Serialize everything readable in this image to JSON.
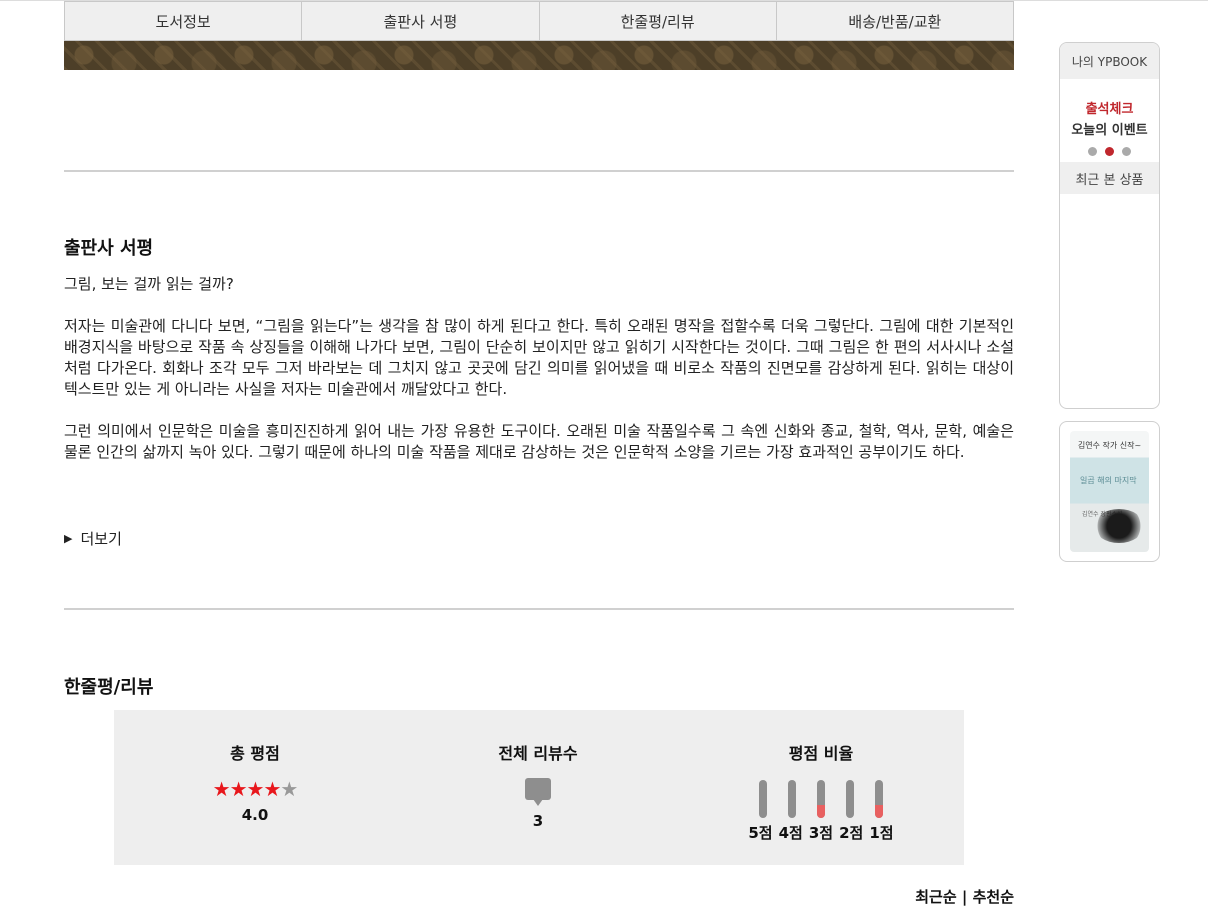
{
  "tabs": [
    "도서정보",
    "출판사 서평",
    "한줄평/리뷰",
    "배송/반품/교환"
  ],
  "publisher_review": {
    "title": "출판사 서평",
    "question": "그림, 보는 걸까 읽는 걸까?",
    "paragraph1": "저자는 미술관에 다니다 보면, “그림을 읽는다”는 생각을 참 많이 하게 된다고 한다. 특히 오래된 명작을 접할수록 더욱 그렇단다. 그림에 대한 기본적인 배경지식을 바탕으로 작품 속 상징들을 이해해 나가다 보면, 그림이 단순히 보이지만 않고 읽히기 시작한다는 것이다. 그때 그림은 한 편의 서사시나 소설처럼 다가온다. 회화나 조각 모두 그저 바라보는 데 그치지 않고 곳곳에 담긴 의미를 읽어냈을 때 비로소 작품의 진면모를 감상하게 된다. 읽히는 대상이 텍스트만 있는 게 아니라는 사실을 저자는 미술관에서 깨달았다고 한다.",
    "paragraph2": "그런 의미에서 인문학은 미술을 흥미진진하게 읽어 내는 가장 유용한 도구이다. 오래된 미술 작품일수록 그 속엔 신화와 종교, 철학, 역사, 문학, 예술은 물론 인간의 삶까지 녹아 있다. 그렇기 때문에 하나의 미술 작품을 제대로 감상하는 것은 인문학적 소양을 기르는 가장 효과적인 공부이기도 하다.",
    "more_label": "더보기"
  },
  "reviews": {
    "title": "한줄평/리뷰",
    "total_rating_label": "총 평점",
    "rating_value": "4.0",
    "stars_filled": 4,
    "stars_total": 5,
    "review_count_label": "전체 리뷰수",
    "review_count": "3",
    "ratio_label": "평점 비율",
    "ratio_bars": [
      {
        "label": "5점",
        "fraction": 0
      },
      {
        "label": "4점",
        "fraction": 0
      },
      {
        "label": "3점",
        "fraction": 0.33
      },
      {
        "label": "2점",
        "fraction": 0
      },
      {
        "label": "1점",
        "fraction": 0.33
      }
    ],
    "sort_recent": "최근순",
    "sort_separator": "|",
    "sort_recommend": "추천순"
  },
  "sidebar": {
    "my_label": "나의 YPBOOK",
    "event_line1": "출석체크",
    "event_line2": "오늘의 이벤트",
    "recent_label": "최근 본 상품",
    "book_cover_title": "김연수 작가 신작~",
    "book_cover_subtitle": "일곱 해의 마지막",
    "book_cover_author": "김연수 장편소설"
  },
  "colors": {
    "accent_red": "#c0272d",
    "star_red": "#e8171c",
    "bar_fill": "#e86060"
  }
}
